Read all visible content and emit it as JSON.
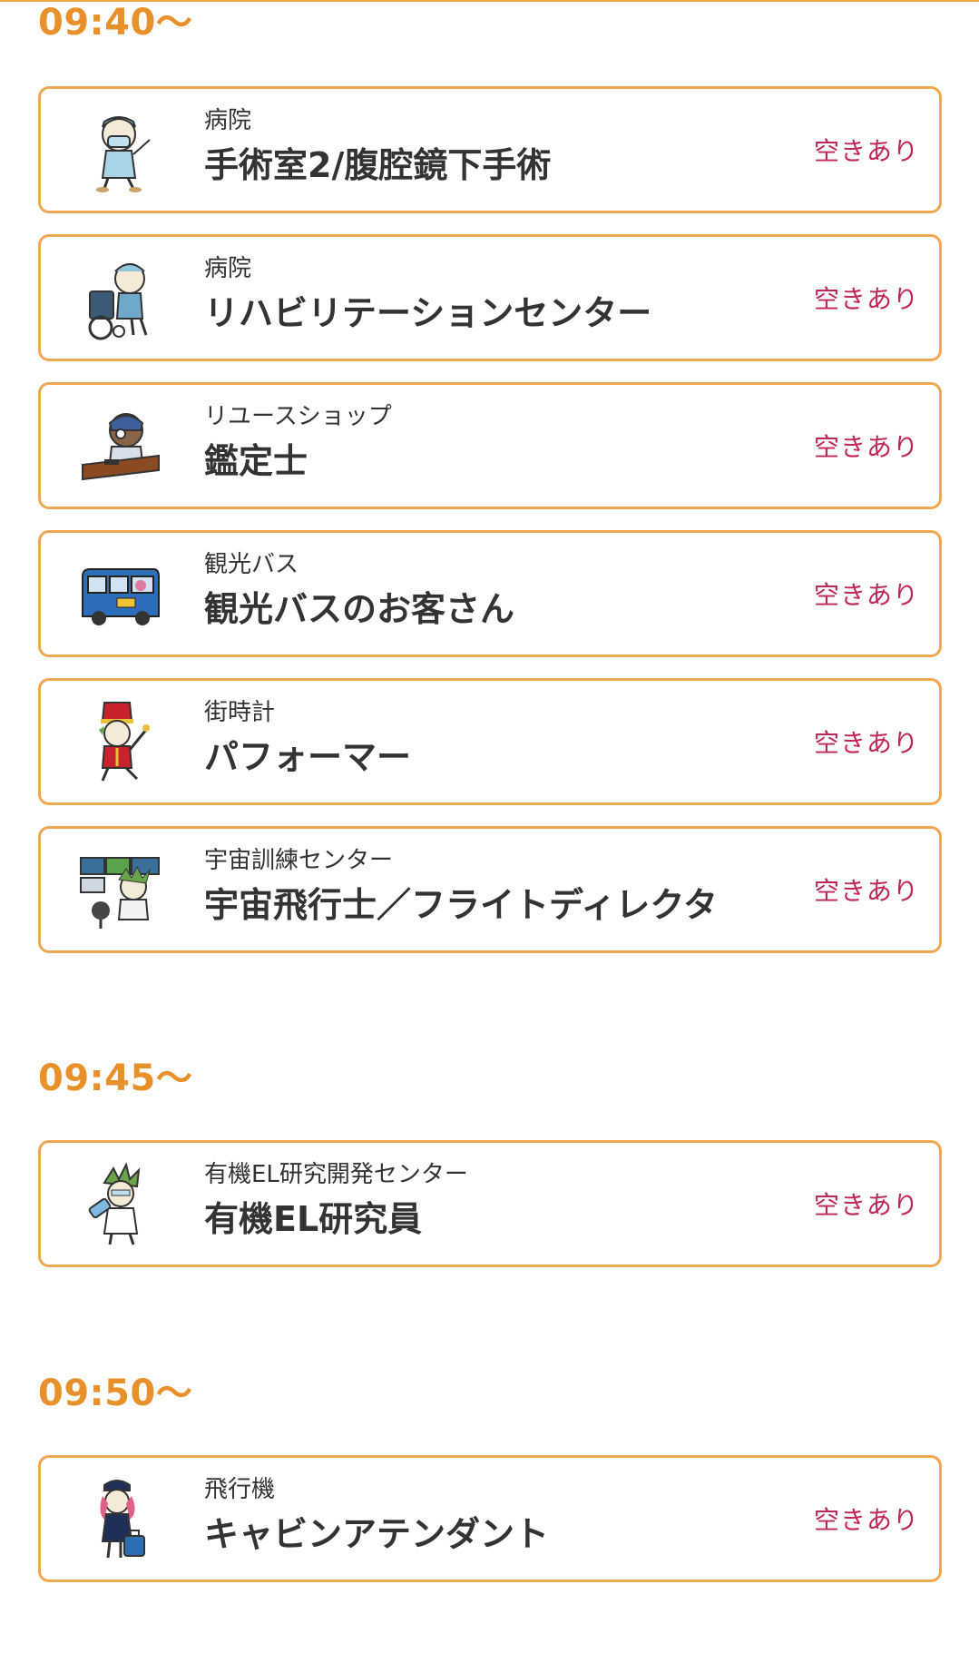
{
  "colors": {
    "accent": "#e8912a",
    "card_border": "#efa750",
    "status": "#c0265a",
    "text": "#333333"
  },
  "sections": [
    {
      "time": "09:40〜",
      "items": [
        {
          "category": "病院",
          "title": "手術室2/腹腔鏡下手術",
          "status": "空きあり",
          "icon": "surgeon-character-icon"
        },
        {
          "category": "病院",
          "title": "リハビリテーションセンター",
          "status": "空きあり",
          "icon": "wheelchair-character-icon"
        },
        {
          "category": "リユースショップ",
          "title": "鑑定士",
          "status": "空きあり",
          "icon": "appraiser-character-icon"
        },
        {
          "category": "観光バス",
          "title": "観光バスのお客さん",
          "status": "空きあり",
          "icon": "tour-bus-icon"
        },
        {
          "category": "街時計",
          "title": "パフォーマー",
          "status": "空きあり",
          "icon": "performer-character-icon"
        },
        {
          "category": "宇宙訓練センター",
          "title": "宇宙飛行士／フライトディレクタ",
          "status": "空きあり",
          "icon": "astronaut-character-icon"
        }
      ]
    },
    {
      "time": "09:45〜",
      "items": [
        {
          "category": "有機EL研究開発センター",
          "title": "有機EL研究員",
          "status": "空きあり",
          "icon": "researcher-character-icon"
        }
      ]
    },
    {
      "time": "09:50〜",
      "items": [
        {
          "category": "飛行機",
          "title": "キャビンアテンダント",
          "status": "空きあり",
          "icon": "cabin-attendant-character-icon"
        }
      ]
    }
  ]
}
